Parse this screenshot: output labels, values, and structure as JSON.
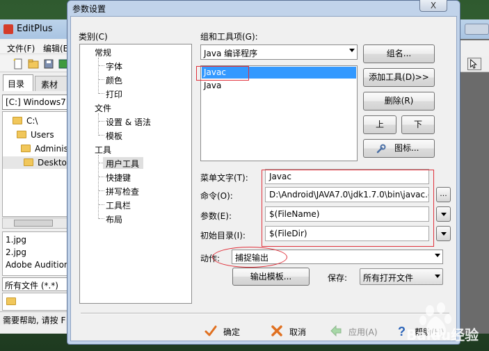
{
  "editplus": {
    "title": "EditPlus",
    "menus": [
      "文件(F)",
      "编辑(E"
    ],
    "tabs": [
      "目录",
      "素材"
    ],
    "drive": "[C:] Windows7",
    "tree": [
      "C:\\",
      "Users",
      "Adminis",
      "Deskto"
    ],
    "files": [
      "1.jpg",
      "2.jpg",
      "Adobe Audition"
    ],
    "filter": "所有文件 (*.*)",
    "status": "需要帮助, 请按 F"
  },
  "dialog": {
    "title": "参数设置",
    "close": "X",
    "category_label": "类别(C)",
    "categories": [
      {
        "label": "常规"
      },
      {
        "label": "字体"
      },
      {
        "label": "颜色"
      },
      {
        "label": "打印"
      },
      {
        "label": "文件"
      },
      {
        "label": "设置 & 语法"
      },
      {
        "label": "模板"
      },
      {
        "label": "工具"
      },
      {
        "label": "用户工具",
        "selected": true
      },
      {
        "label": "快捷键"
      },
      {
        "label": "拼写检查"
      },
      {
        "label": "工具栏"
      },
      {
        "label": "布局"
      }
    ],
    "group_label": "组和工具项(G):",
    "group_value": "Java 编译程序",
    "tools": [
      "Javac",
      "Java"
    ],
    "buttons": {
      "group_name": "组名...",
      "add_tool": "添加工具(D)>>",
      "delete": "删除(R)",
      "up": "上",
      "down": "下",
      "icon": "图标..."
    },
    "fields": {
      "menu_label": "菜单文字(T):",
      "menu_value": "Javac",
      "cmd_label": "命令(O):",
      "cmd_value": "D:\\Android\\JAVA7.0\\jdk1.7.0\\bin\\javac.exe",
      "arg_label": "参数(E):",
      "arg_value": "$(FileName)",
      "dir_label": "初始目录(I):",
      "dir_value": "$(FileDir)",
      "browse": "..."
    },
    "action_label": "动作:",
    "action_value": "捕捉输出",
    "output_template": "输出模板...",
    "save_label": "保存:",
    "save_value": "所有打开文件",
    "footer": {
      "ok": "确定",
      "cancel": "取消",
      "apply": "应用(A)",
      "help": "帮助(H)"
    }
  },
  "watermark": {
    "text": "Baidu经验"
  },
  "colors": {
    "highlight_red": "#e0303a",
    "selection_blue": "#3399ff",
    "dialog_frame": "#c1d3ea"
  }
}
